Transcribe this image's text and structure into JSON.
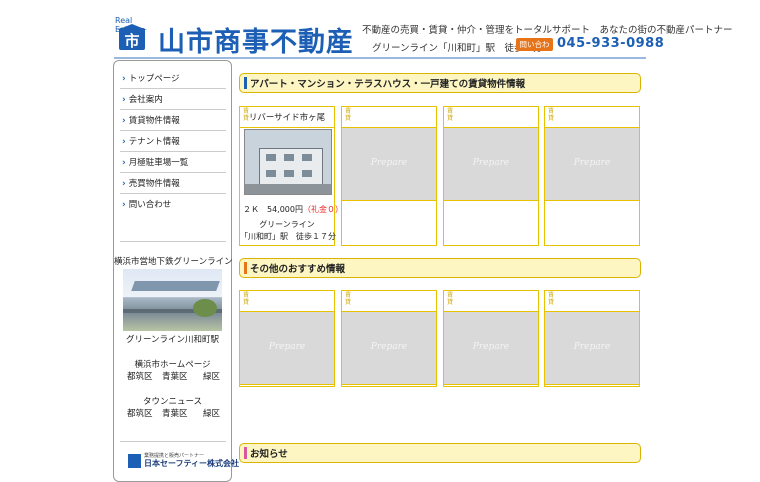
{
  "header": {
    "logo_tag": "Real Estate",
    "logo_badge": "市",
    "company_name": "山市商事不動産",
    "tagline": "不動産の売買・賃貸・仲介・管理をトータルサポート　あなたの街の不動産パートナー",
    "access": "グリーンライン「川和町」駅　徒歩１分",
    "contact_label": "問い合わせ",
    "phone": "045-933-0988"
  },
  "sidebar": {
    "nav": [
      {
        "label": "トップページ"
      },
      {
        "label": "会社案内"
      },
      {
        "label": "賃貸物件情報"
      },
      {
        "label": "テナント情報"
      },
      {
        "label": "月極駐車場一覧"
      },
      {
        "label": "売買物件情報"
      },
      {
        "label": "問い合わせ"
      }
    ],
    "subway_title": "横浜市営地下鉄グリーンライン",
    "station_caption": "グリーンライン川和町駅",
    "city_homepage": "横浜市ホームページ",
    "city_wards": [
      "都筑区",
      "青葉区",
      "緑区"
    ],
    "town_news": "タウンニュース",
    "news_wards": [
      "都筑区",
      "青葉区",
      "緑区"
    ],
    "partner_sub": "業務提携と販売パートナー",
    "partner_name": "日本セーフティー株式会社"
  },
  "sections": {
    "rental": {
      "title": "アパート・マンション・テラスハウス・一戸建ての賃貸物件情報",
      "cards": [
        {
          "tag": "賃貸",
          "name": "リバーサイド市ヶ尾",
          "price_prefix": "２Ｋ　54,000円",
          "price_note": "（礼金０）",
          "line1": "グリーンライン",
          "line2": "「川和町」駅　徒歩１７分",
          "prepare": ""
        },
        {
          "tag": "賃貸",
          "name": "",
          "price_prefix": "",
          "price_note": "",
          "line1": "",
          "line2": "",
          "prepare": "Prepare"
        },
        {
          "tag": "賃貸",
          "name": "",
          "price_prefix": "",
          "price_note": "",
          "line1": "",
          "line2": "",
          "prepare": "Prepare"
        },
        {
          "tag": "賃貸",
          "name": "",
          "price_prefix": "",
          "price_note": "",
          "line1": "",
          "line2": "",
          "prepare": "Prepare"
        }
      ]
    },
    "recommend": {
      "title": "その他のおすすめ情報",
      "cards": [
        {
          "tag": "賃貸",
          "prepare": "Prepare"
        },
        {
          "tag": "賃貸",
          "prepare": "Prepare"
        },
        {
          "tag": "賃貸",
          "prepare": "Prepare"
        },
        {
          "tag": "賃貸",
          "prepare": "Prepare"
        }
      ]
    },
    "notice": {
      "title": "お知らせ"
    }
  },
  "colors": {
    "brand_blue": "#1c5fb4",
    "section_bar_rental": "#1c5fb4",
    "section_bar_recommend": "#e8741a",
    "section_bar_notice": "#d8589b",
    "accent_gold": "#e6c200",
    "contact_orange": "#e8741a"
  }
}
